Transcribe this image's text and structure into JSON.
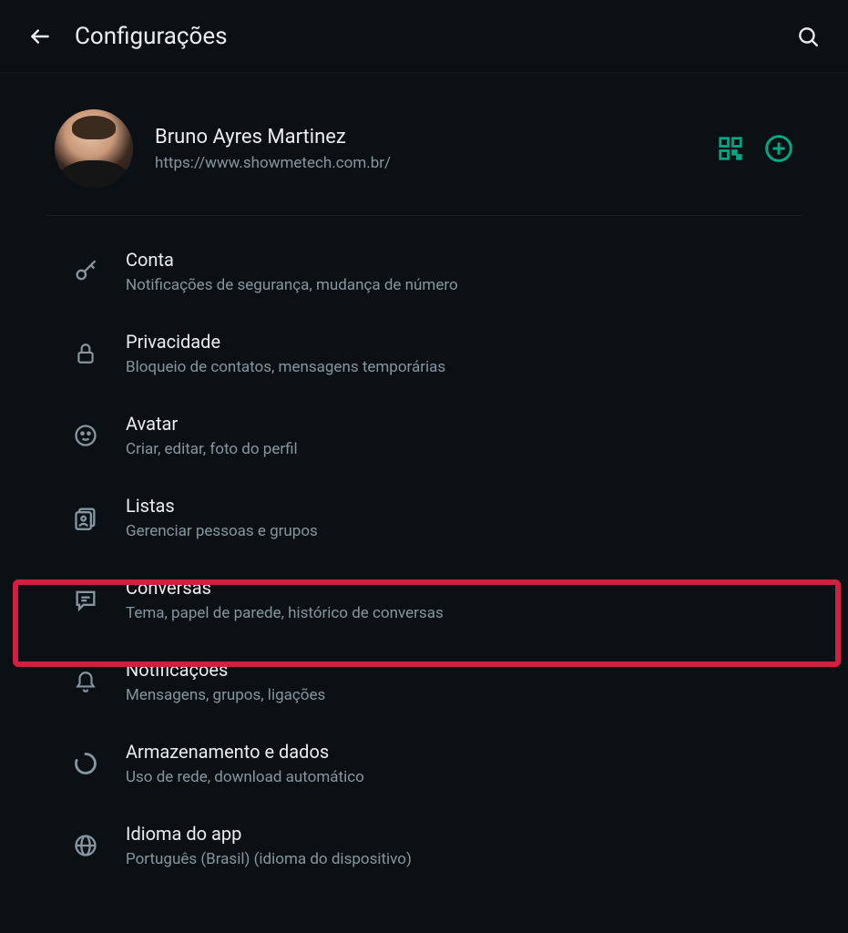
{
  "header": {
    "title": "Configurações"
  },
  "profile": {
    "name": "Bruno Ayres Martinez",
    "subtitle": "https://www.showmetech.com.br/"
  },
  "menu": [
    {
      "title": "Conta",
      "subtitle": "Notificações de segurança, mudança de número"
    },
    {
      "title": "Privacidade",
      "subtitle": "Bloqueio de contatos, mensagens temporárias"
    },
    {
      "title": "Avatar",
      "subtitle": "Criar, editar, foto do perfil"
    },
    {
      "title": "Listas",
      "subtitle": "Gerenciar pessoas e grupos"
    },
    {
      "title": "Conversas",
      "subtitle": "Tema, papel de parede, histórico de conversas"
    },
    {
      "title": "Notificações",
      "subtitle": "Mensagens, grupos, ligações"
    },
    {
      "title": "Armazenamento e dados",
      "subtitle": "Uso de rede, download automático"
    },
    {
      "title": "Idioma do app",
      "subtitle": "Português (Brasil) (idioma do dispositivo)"
    }
  ],
  "colors": {
    "accent": "#00a884",
    "highlight": "#d1203f"
  }
}
